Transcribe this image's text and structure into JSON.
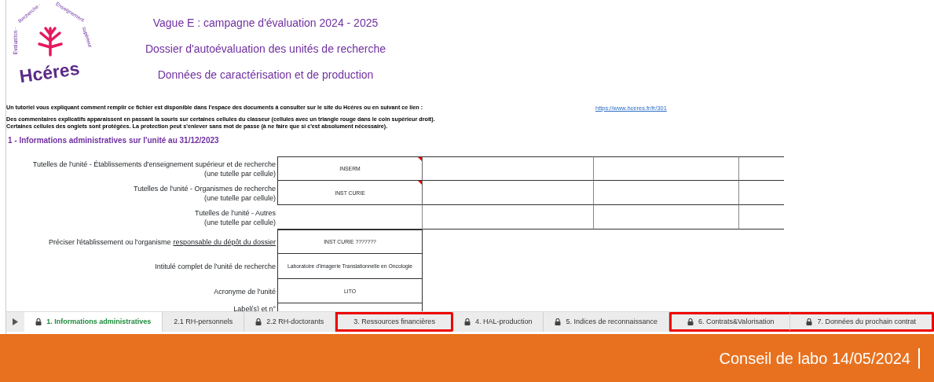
{
  "logo": {
    "name": "Hcéres",
    "tagline": [
      "Évaluation ·",
      "Recherche ·",
      "Enseignement",
      "supérieur"
    ]
  },
  "titles": [
    "Vague E : campagne d'évaluation 2024 - 2025",
    "Dossier d'autoévaluation des unités de recherche",
    "Données de caractérisation et de production"
  ],
  "notes": [
    {
      "text": "Un tutoriel vous expliquant comment remplir ce fichier est disponible dans l'espace des documents à consulter sur le site du Hcéres ou en suivant ce lien :",
      "link": "https://www.hceres.fr/fr/301"
    },
    {
      "text": "Des commentaires explicatifs apparaissent en passant la souris sur certaines cellules du classeur (cellules avec un triangle rouge dans le coin supérieur droit)."
    },
    {
      "text": "Certaines cellules des onglets sont protégées. La protection peut s'enlever sans mot de passe (à ne faire que si c'est absolument nécessaire)."
    }
  ],
  "section_title": "1 - Informations administratives sur l'unité au 31/12/2023",
  "rows": [
    {
      "label": "Tutelles de l'unité - Établissements d'enseignement supérieur et de recherche\n(une tutelle par cellule)",
      "value": "INSERM",
      "comment": true,
      "extended": true
    },
    {
      "label": "Tutelles de l'unité - Organismes de recherche\n(une tutelle par cellule)",
      "value": "INST CURIE",
      "comment": true,
      "extended": true
    },
    {
      "label": "Tutelles de l'unité - Autres\n(une tutelle par cellule)",
      "comment": false,
      "extended": true
    },
    {
      "label": "Préciser l'établissement ou l'organisme",
      "label_underlined": "responsable du dépôt du dossier",
      "value": "INST CURIE ???????",
      "comment": false,
      "extended": false
    },
    {
      "label": "Intitulé complet de l'unité de recherche",
      "value": "Laboratoire d'Imagerie Translationnelle en Oncologie",
      "comment": false,
      "extended": false
    },
    {
      "label": "Acronyme de l'unité",
      "value": "LITO",
      "comment": false,
      "extended": false
    },
    {
      "label": "Label(s) et n°",
      "comment": false,
      "extended": false
    }
  ],
  "tabs": [
    {
      "label": "1. Informations administratives",
      "locked": true,
      "selected": true,
      "highlighted": false
    },
    {
      "label": "2.1 RH-personnels",
      "locked": false,
      "selected": false,
      "highlighted": false
    },
    {
      "label": "2.2 RH-doctorants",
      "locked": true,
      "selected": false,
      "highlighted": false
    },
    {
      "label": "3. Ressources financières",
      "locked": false,
      "selected": false,
      "highlighted": true
    },
    {
      "label": "4. HAL-production",
      "locked": true,
      "selected": false,
      "highlighted": false
    },
    {
      "label": "5. Indices de reconnaissance",
      "locked": true,
      "selected": false,
      "highlighted": false
    },
    {
      "label": "6. Contrats&Valorisation",
      "locked": true,
      "selected": false,
      "highlighted": true
    },
    {
      "label": "7. Données du prochain contrat",
      "locked": true,
      "selected": false,
      "highlighted": true
    }
  ],
  "footer": "Conseil de labo 14/05/2024"
}
